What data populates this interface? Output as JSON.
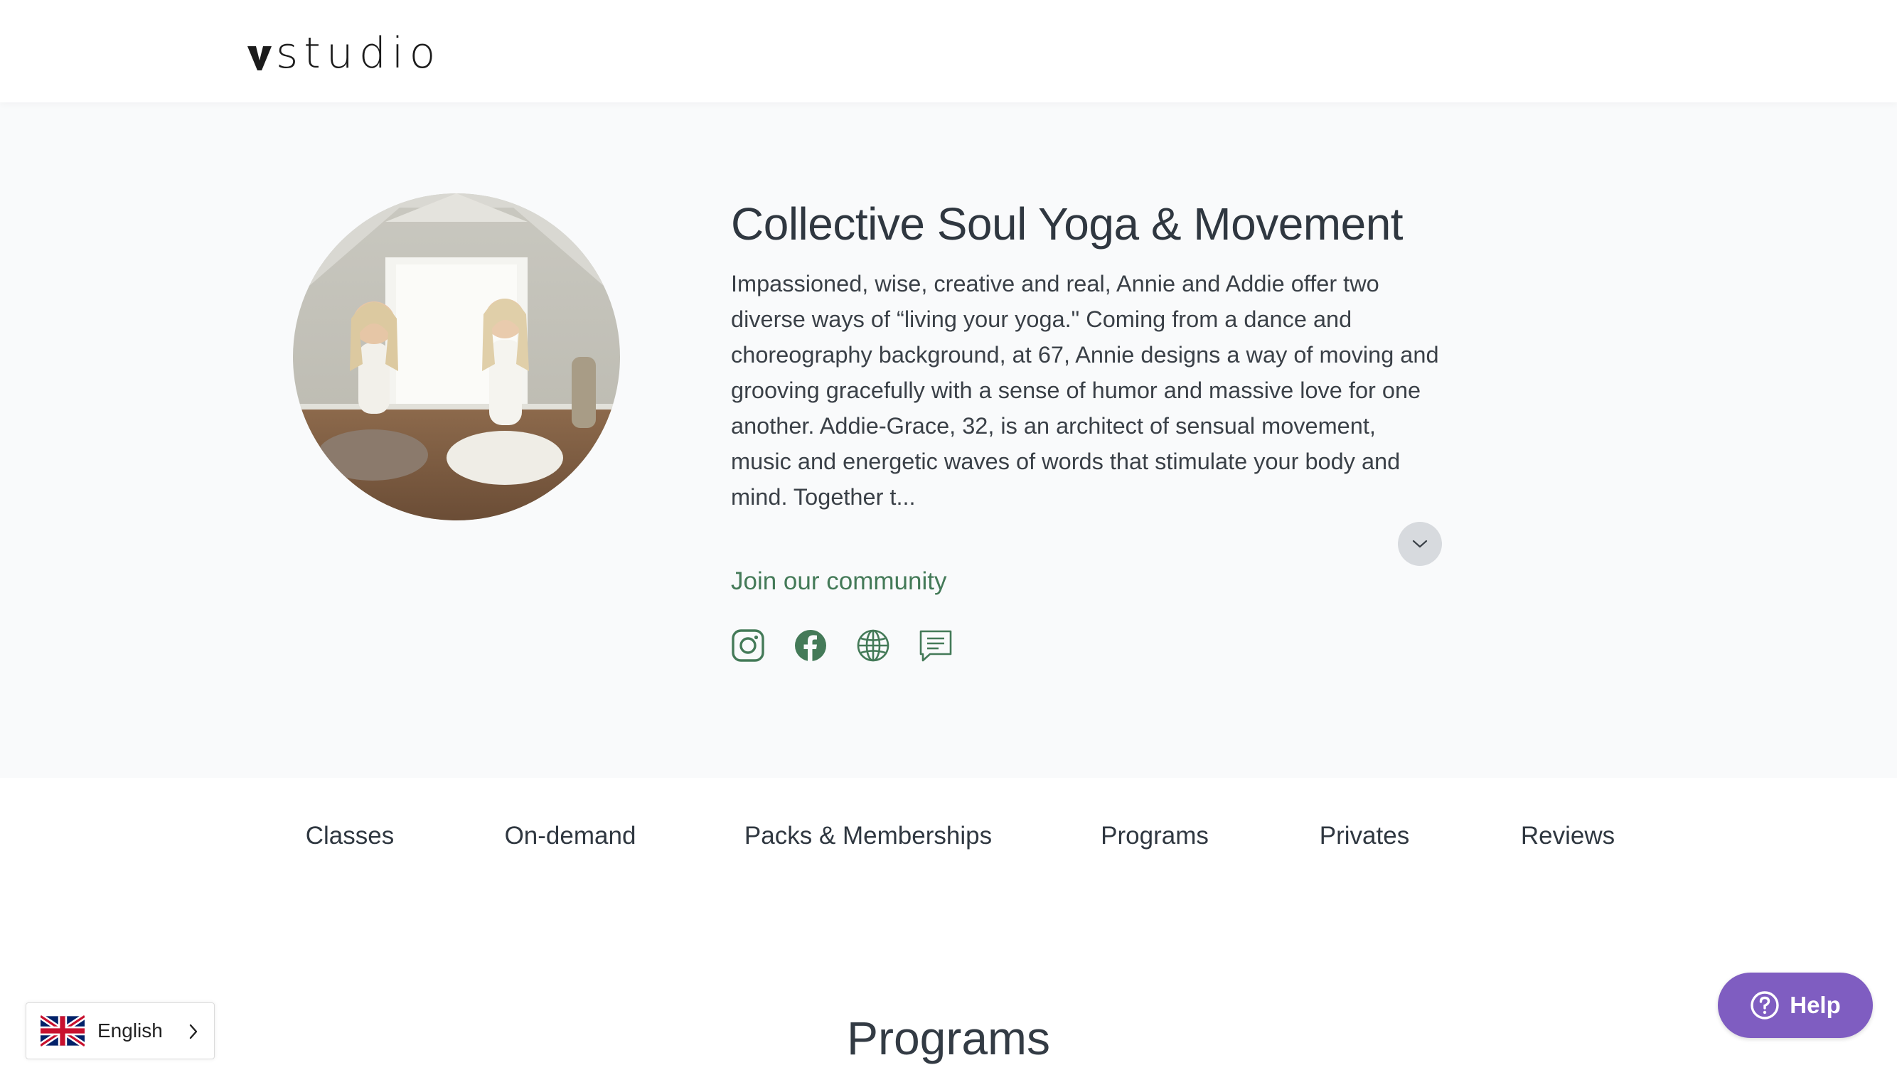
{
  "brand": {
    "logo_text": "studio"
  },
  "studio": {
    "name": "Collective Soul Yoga & Movement",
    "description": "Impassioned, wise, creative and real, Annie and Addie offer two diverse ways of “living your yoga.\" Coming from a dance and choreography background, at 67, Annie designs a way of moving and grooving gracefully with a sense of humor and massive love for one another. Addie-Grace, 32, is an architect of sensual movement, music and energetic waves of words that stimulate your body and mind. Together t..."
  },
  "community": {
    "link_label": "Join our community",
    "icons": [
      "instagram-icon",
      "facebook-icon",
      "globe-icon",
      "chat-icon"
    ]
  },
  "tabs": [
    "Classes",
    "On-demand",
    "Packs & Memberships",
    "Programs",
    "Privates",
    "Reviews"
  ],
  "section": {
    "heading": "Programs"
  },
  "language": {
    "label": "English"
  },
  "help": {
    "label": "Help"
  },
  "colors": {
    "accent_green": "#447a58",
    "help_purple": "#7f5dc1",
    "hero_bg": "#f9fafb"
  }
}
